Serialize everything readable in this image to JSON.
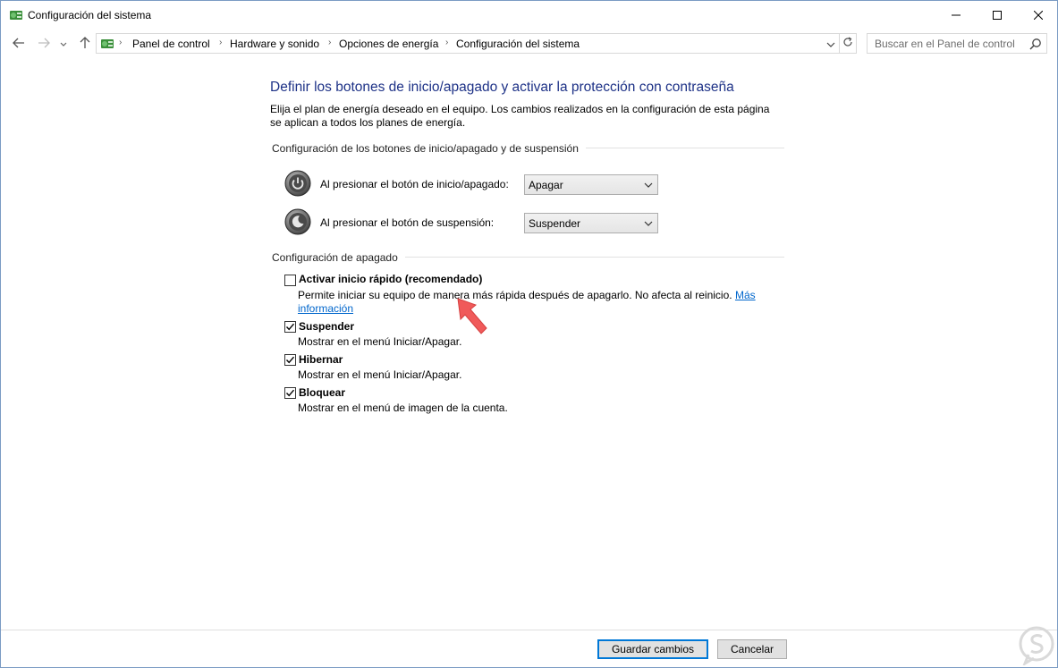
{
  "window": {
    "title": "Configuración del sistema",
    "minimize_icon": "minimize-icon",
    "maximize_icon": "maximize-icon",
    "close_icon": "close-icon"
  },
  "address_bar": {
    "breadcrumbs": [
      "Panel de control",
      "Hardware y sonido",
      "Opciones de energía",
      "Configuración del sistema"
    ],
    "search_placeholder": "Buscar en el Panel de control"
  },
  "main": {
    "heading": "Definir los botones de inicio/apagado y activar la protección con contraseña",
    "description": "Elija el plan de energía deseado en el equipo. Los cambios realizados en la configuración de esta página se aplican a todos los planes de energía.",
    "buttons_section": {
      "title": "Configuración de los botones de inicio/apagado y de suspensión",
      "power_button_label": "Al presionar el botón de inicio/apagado:",
      "power_button_value": "Apagar",
      "sleep_button_label": "Al presionar el botón de suspensión:",
      "sleep_button_value": "Suspender"
    },
    "shutdown_section": {
      "title": "Configuración de apagado",
      "fast_startup": {
        "label": "Activar inicio rápido (recomendado)",
        "checked": false,
        "description": "Permite iniciar su equipo de manera más rápida después de apagarlo. No afecta al reinicio.",
        "link_part1": "Más",
        "link_part2": "información"
      },
      "suspend": {
        "label": "Suspender",
        "checked": true,
        "description": "Mostrar en el menú Iniciar/Apagar."
      },
      "hibernate": {
        "label": "Hibernar",
        "checked": true,
        "description": "Mostrar en el menú Iniciar/Apagar."
      },
      "lock": {
        "label": "Bloquear",
        "checked": true,
        "description": "Mostrar en el menú de imagen de la cuenta."
      }
    }
  },
  "footer": {
    "save_label": "Guardar cambios",
    "cancel_label": "Cancelar"
  },
  "colors": {
    "heading": "#1e3287",
    "link": "#0066cc",
    "annotation_arrow": "#f05a5a",
    "default_button_border": "#0078d7"
  }
}
